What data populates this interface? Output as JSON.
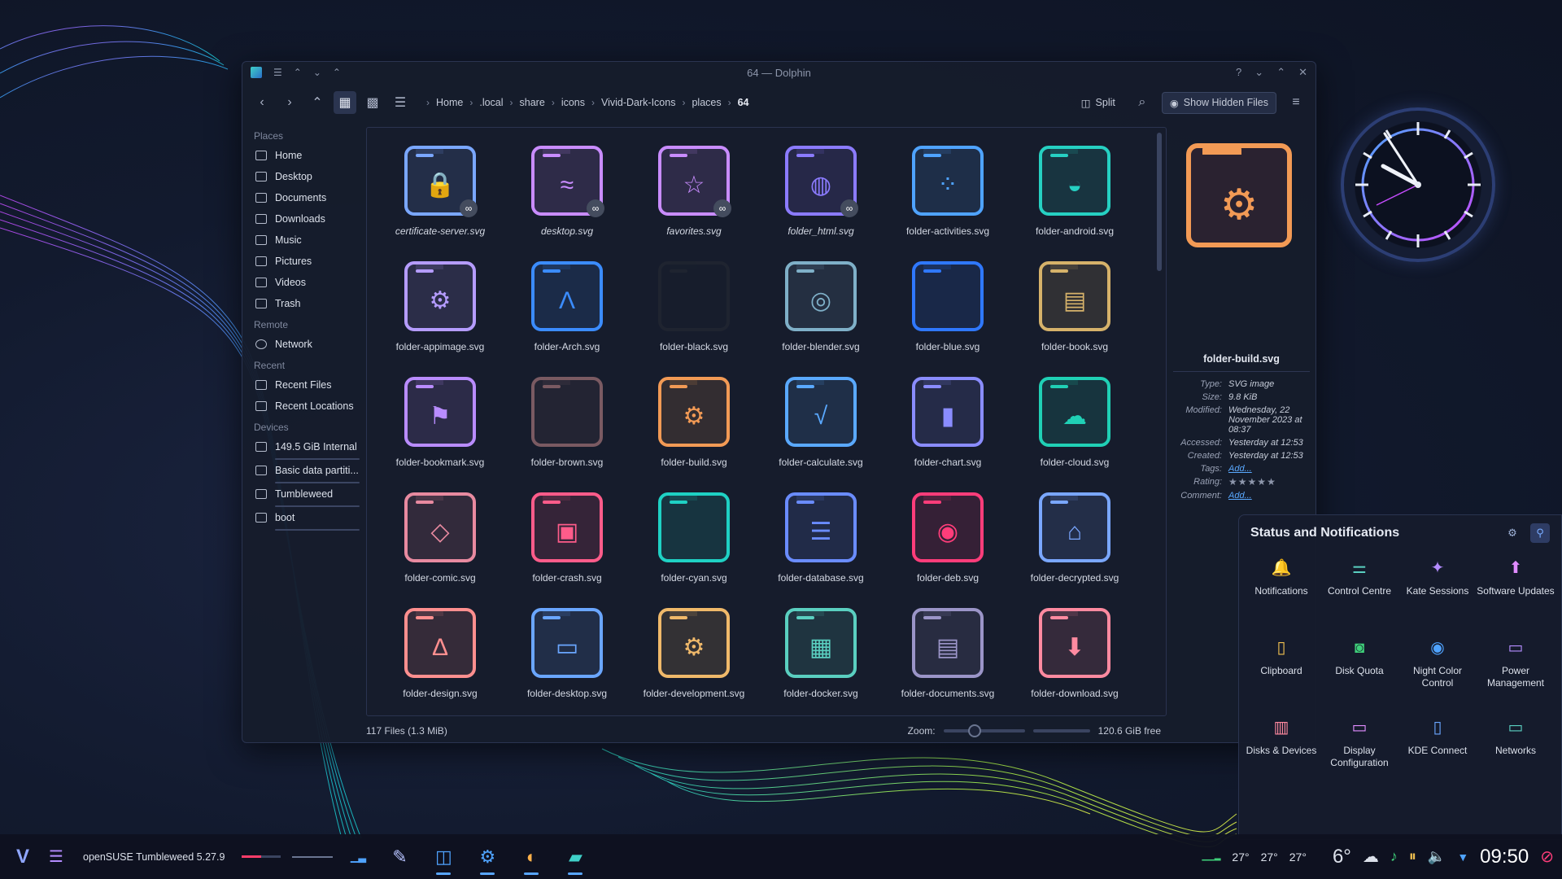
{
  "window": {
    "title": "64 — Dolphin",
    "help": "?",
    "titlebar_buttons": [
      "chevron-down-icon",
      "maximize-icon",
      "close-icon"
    ]
  },
  "toolbar": {
    "breadcrumb": [
      "Home",
      ".local",
      "share",
      "icons",
      "Vivid-Dark-Icons",
      "places",
      "64"
    ],
    "split_label": "Split",
    "hidden_label": "Show Hidden Files"
  },
  "sidebar": {
    "places_heading": "Places",
    "places": [
      "Home",
      "Desktop",
      "Documents",
      "Downloads",
      "Music",
      "Pictures",
      "Videos",
      "Trash"
    ],
    "remote_heading": "Remote",
    "remote": [
      "Network"
    ],
    "recent_heading": "Recent",
    "recent": [
      "Recent Files",
      "Recent Locations"
    ],
    "devices_heading": "Devices",
    "devices": [
      "149.5 GiB Internal ...",
      "Basic data partiti...",
      "Tumbleweed",
      "boot"
    ]
  },
  "files": [
    {
      "name": "certificate-server.svg",
      "glyph": "lock-icon",
      "color": "#7aa7ff",
      "link": true
    },
    {
      "name": "desktop.svg",
      "glyph": "wave-icon",
      "color": "#c98cff",
      "link": true
    },
    {
      "name": "favorites.svg",
      "glyph": "star-icon",
      "color": "#c98cff",
      "link": true
    },
    {
      "name": "folder_html.svg",
      "glyph": "globe-icon",
      "color": "#8b7bff",
      "link": true
    },
    {
      "name": "folder-activities.svg",
      "glyph": "activities-icon",
      "color": "#4fa3ff",
      "link": false
    },
    {
      "name": "folder-android.svg",
      "glyph": "android-icon",
      "color": "#26d0c2",
      "link": false
    },
    {
      "name": "folder-appimage.svg",
      "glyph": "gear-download-icon",
      "color": "#b59cff",
      "link": false
    },
    {
      "name": "folder-Arch.svg",
      "glyph": "arch-icon",
      "color": "#3b8cff",
      "link": false
    },
    {
      "name": "folder-black.svg",
      "glyph": "",
      "color": "#1f2430",
      "link": false
    },
    {
      "name": "folder-blender.svg",
      "glyph": "blender-icon",
      "color": "#7fb0c8",
      "link": false
    },
    {
      "name": "folder-blue.svg",
      "glyph": "",
      "color": "#2f78ff",
      "link": false
    },
    {
      "name": "folder-book.svg",
      "glyph": "book-icon",
      "color": "#d6b26a",
      "link": false
    },
    {
      "name": "folder-bookmark.svg",
      "glyph": "bookmark-icon",
      "color": "#b98cff",
      "link": false
    },
    {
      "name": "folder-brown.svg",
      "glyph": "",
      "color": "#7a5a62",
      "link": false
    },
    {
      "name": "folder-build.svg",
      "glyph": "gears-icon",
      "color": "#f29a55",
      "link": false
    },
    {
      "name": "folder-calculate.svg",
      "glyph": "sqrt-icon",
      "color": "#5aa9ff",
      "link": false
    },
    {
      "name": "folder-chart.svg",
      "glyph": "chart-icon",
      "color": "#8a8cff",
      "link": false
    },
    {
      "name": "folder-cloud.svg",
      "glyph": "cloud-icon",
      "color": "#20d0b5",
      "link": false
    },
    {
      "name": "folder-comic.svg",
      "glyph": "speech-icon",
      "color": "#e88aa0",
      "link": false
    },
    {
      "name": "folder-crash.svg",
      "glyph": "crash-icon",
      "color": "#ff5c8a",
      "link": false
    },
    {
      "name": "folder-cyan.svg",
      "glyph": "",
      "color": "#1fd1c4",
      "link": false
    },
    {
      "name": "folder-database.svg",
      "glyph": "database-icon",
      "color": "#6a8cff",
      "link": false
    },
    {
      "name": "folder-deb.svg",
      "glyph": "debian-icon",
      "color": "#ff3d7a",
      "link": false
    },
    {
      "name": "folder-decrypted.svg",
      "glyph": "unlock-icon",
      "color": "#7aa7ff",
      "link": false
    },
    {
      "name": "folder-design.svg",
      "glyph": "compass-icon",
      "color": "#ff8f8f",
      "link": false
    },
    {
      "name": "folder-desktop.svg",
      "glyph": "monitor-icon",
      "color": "#6aa6ff",
      "link": false
    },
    {
      "name": "folder-development.svg",
      "glyph": "gear-icon",
      "color": "#f0b96a",
      "link": false
    },
    {
      "name": "folder-docker.svg",
      "glyph": "docker-icon",
      "color": "#5acfc0",
      "link": false
    },
    {
      "name": "folder-documents.svg",
      "glyph": "documents-icon",
      "color": "#9b95c8",
      "link": false
    },
    {
      "name": "folder-download.svg",
      "glyph": "download-icon",
      "color": "#ff8aa0",
      "link": false
    }
  ],
  "status": {
    "count": "117 Files (1.3 MiB)",
    "zoom_label": "Zoom:",
    "free": "120.6 GiB free"
  },
  "info": {
    "name": "folder-build.svg",
    "rows": [
      {
        "k": "Type:",
        "v": "SVG image"
      },
      {
        "k": "Size:",
        "v": "9.8 KiB"
      },
      {
        "k": "Modified:",
        "v": "Wednesday, 22 November 2023 at 08:37"
      },
      {
        "k": "Accessed:",
        "v": "Yesterday at 12:53"
      },
      {
        "k": "Created:",
        "v": "Yesterday at 12:53"
      }
    ],
    "tags_k": "Tags:",
    "tags_v": "Add...",
    "rating_k": "Rating:",
    "comment_k": "Comment:",
    "comment_v": "Add..."
  },
  "notifications": {
    "title": "Status and Notifications",
    "items": [
      {
        "label": "Notifications",
        "icon": "bell-icon",
        "color": "#b48cff"
      },
      {
        "label": "Control Centre",
        "icon": "sliders-icon",
        "color": "#5acfc0"
      },
      {
        "label": "Kate Sessions",
        "icon": "kate-icon",
        "color": "#b48cff"
      },
      {
        "label": "Software Updates",
        "icon": "update-icon",
        "color": "#e08cff"
      },
      {
        "label": "Clipboard",
        "icon": "clipboard-icon",
        "color": "#f0c050"
      },
      {
        "label": "Disk Quota",
        "icon": "disk-quota-icon",
        "color": "#3fd07a"
      },
      {
        "label": "Night Color Control",
        "icon": "night-color-icon",
        "color": "#4fa3ff"
      },
      {
        "label": "Power Management",
        "icon": "power-icon",
        "color": "#b48cff"
      },
      {
        "label": "Disks & Devices",
        "icon": "usb-icon",
        "color": "#ff8aa0"
      },
      {
        "label": "Display Configuration",
        "icon": "display-icon",
        "color": "#e08cff"
      },
      {
        "label": "KDE Connect",
        "icon": "phone-icon",
        "color": "#6aa6ff"
      },
      {
        "label": "Networks",
        "icon": "network-icon",
        "color": "#5acfc0"
      }
    ]
  },
  "taskbar": {
    "distro": "openSUSE Tumbleweed 5.27.9",
    "temps": [
      "27°",
      "27°",
      "27°"
    ],
    "weather_temp": "6°",
    "time": "09:50"
  }
}
